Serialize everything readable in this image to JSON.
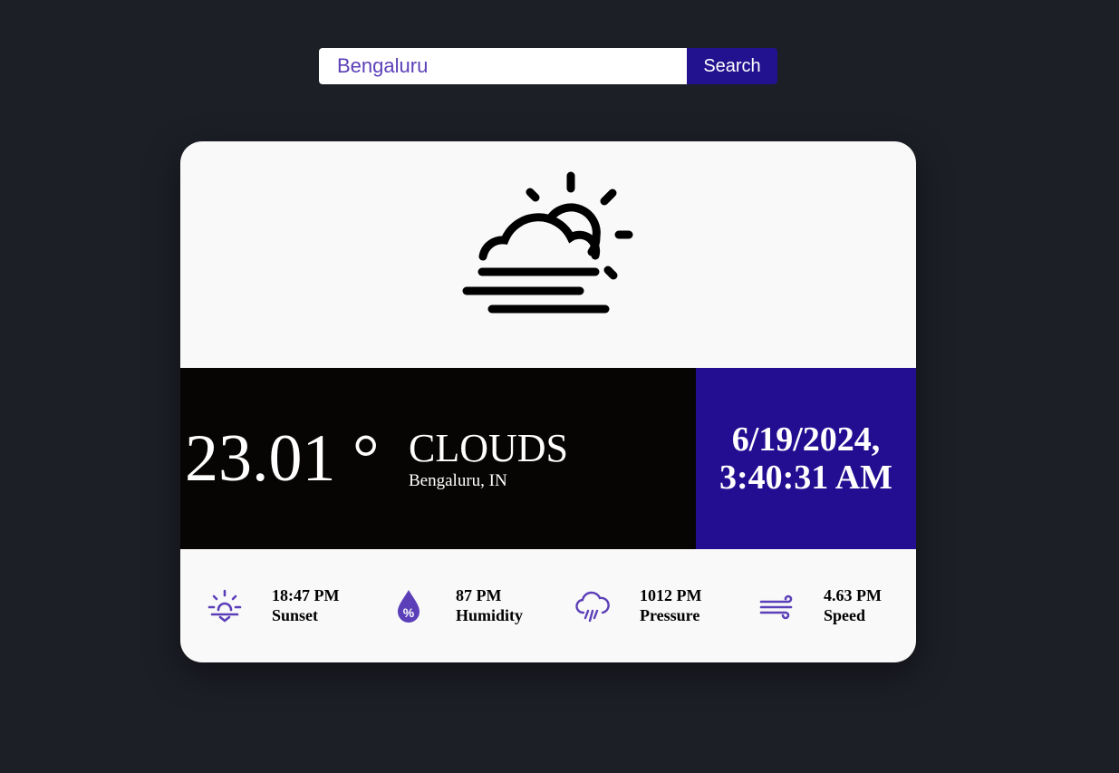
{
  "search": {
    "value": "Bengaluru",
    "button_label": "Search"
  },
  "weather": {
    "icon": "sun-behind-cloud-fog-icon",
    "temperature": "23.01 °",
    "condition": "CLOUDS",
    "location": "Bengaluru, IN",
    "date": "6/19/2024,",
    "time": "3:40:31 AM"
  },
  "stats": [
    {
      "icon": "sunset-icon",
      "value": "18:47 PM",
      "label": "Sunset"
    },
    {
      "icon": "humidity-drop-icon",
      "value": "87 PM",
      "label": "Humidity"
    },
    {
      "icon": "rain-cloud-icon",
      "value": "1012 PM",
      "label": "Pressure"
    },
    {
      "icon": "wind-icon",
      "value": "4.63 PM",
      "label": "Speed"
    }
  ],
  "colors": {
    "page_background": "#1d1f27",
    "card_background": "#f9f9f9",
    "band_dark": "#070504",
    "accent_purple": "#230e92",
    "icon_purple": "#5b3fb8"
  }
}
